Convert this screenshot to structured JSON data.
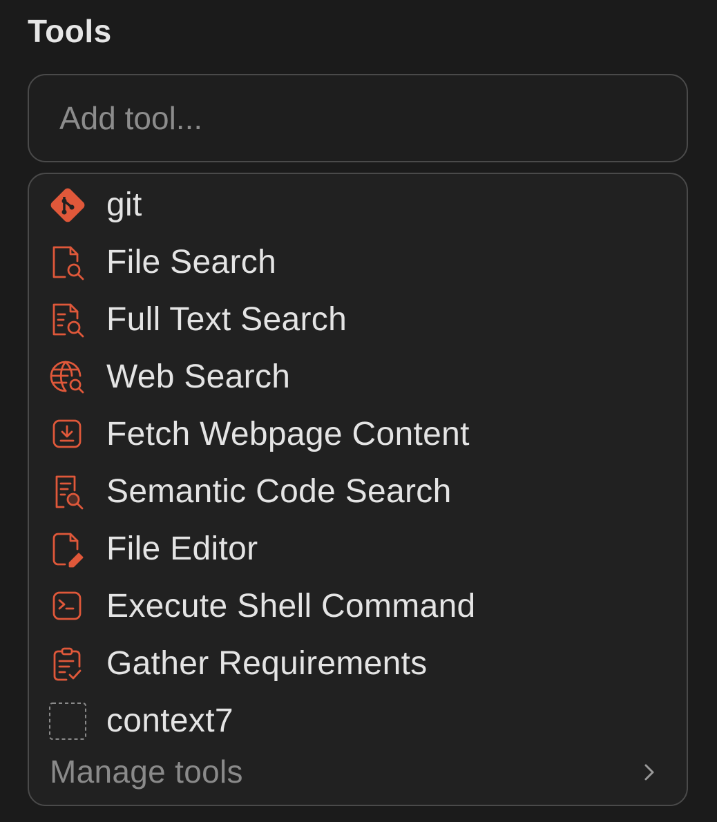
{
  "header": {
    "title": "Tools"
  },
  "input": {
    "placeholder": "Add tool..."
  },
  "tools": [
    {
      "label": "git",
      "icon": "git-icon"
    },
    {
      "label": "File Search",
      "icon": "file-search-icon"
    },
    {
      "label": "Full Text Search",
      "icon": "full-text-search-icon"
    },
    {
      "label": "Web Search",
      "icon": "web-search-icon"
    },
    {
      "label": "Fetch Webpage Content",
      "icon": "download-icon"
    },
    {
      "label": "Semantic Code Search",
      "icon": "code-search-icon"
    },
    {
      "label": "File Editor",
      "icon": "file-edit-icon"
    },
    {
      "label": "Execute Shell Command",
      "icon": "terminal-icon"
    },
    {
      "label": "Gather Requirements",
      "icon": "clipboard-check-icon"
    },
    {
      "label": "context7",
      "icon": "placeholder-icon"
    }
  ],
  "footer": {
    "manage_label": "Manage tools",
    "chevron_icon": "chevron-right-icon"
  },
  "colors": {
    "background": "#1b1b1b",
    "panel": "#212121",
    "border": "#4a4a4a",
    "accent": "#e0583a",
    "text": "#e4e4e4",
    "muted": "#8a8a8a"
  }
}
